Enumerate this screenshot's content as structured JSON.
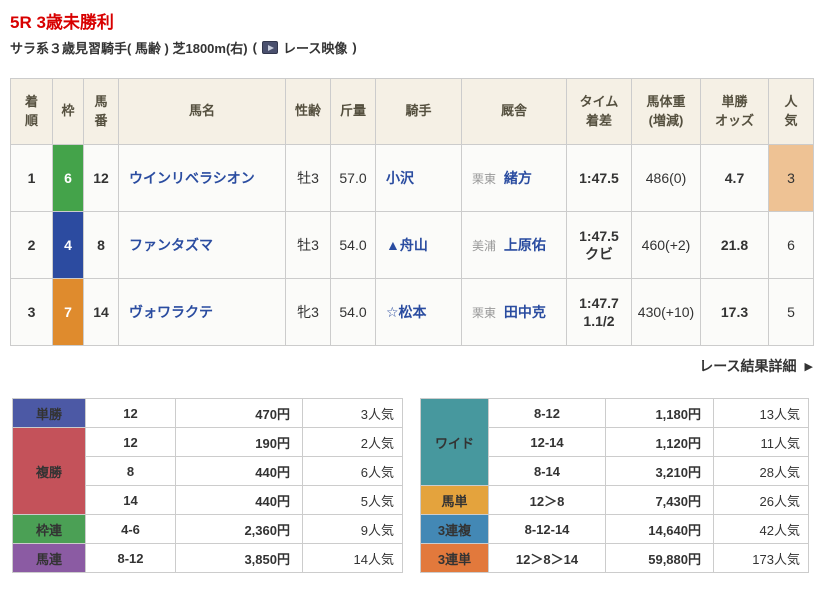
{
  "colors": {
    "title_red": "#d80000",
    "link_blue": "#2a4ca0",
    "header_beige": "#f5f0e5",
    "frame_6_green": "#44a34a",
    "frame_4_blue": "#2c4ba0",
    "frame_7_orange": "#df8b2d",
    "favorite_highlight": "#eec294"
  },
  "header": {
    "race_title": "5R 3歳未勝利",
    "race_conditions": "サラ系３歳見習騎手( 馬齢 ) 芝1800m(右)",
    "paren_open": "(",
    "video_link_label": "レース映像",
    "paren_close": ")"
  },
  "results": {
    "columns": [
      "着\n順",
      "枠",
      "馬\n番",
      "馬名",
      "性齢",
      "斤量",
      "騎手",
      "厩舎",
      "タイム\n着差",
      "馬体重\n(増減)",
      "単勝\nオッズ",
      "人\n気"
    ],
    "rows": [
      {
        "finish": "1",
        "frame": "6",
        "frame_style": "background:#44a34a;color:#ffffff",
        "number": "12",
        "name": "ウインリベラシオン",
        "sex_age": "牡3",
        "weight": "57.0",
        "jockey": "小沢",
        "stable_region": "栗東",
        "trainer": "緒方",
        "time": "1:47.5",
        "margin": "",
        "body_weight": "486(0)",
        "odds": "4.7",
        "favorite": "3",
        "favorite_style": "background:#eec294"
      },
      {
        "finish": "2",
        "frame": "4",
        "frame_style": "background:#2c4ba0;color:#ffffff",
        "number": "8",
        "name": "ファンタズマ",
        "sex_age": "牡3",
        "weight": "54.0",
        "jockey": "▲舟山",
        "stable_region": "美浦",
        "trainer": "上原佑",
        "time": "1:47.5",
        "margin": "クビ",
        "body_weight": "460(+2)",
        "odds": "21.8",
        "favorite": "6"
      },
      {
        "finish": "3",
        "frame": "7",
        "frame_style": "background:#df8b2d;color:#ffffff",
        "number": "14",
        "name": "ヴォワラクテ",
        "sex_age": "牝3",
        "weight": "54.0",
        "jockey": "☆松本",
        "stable_region": "栗東",
        "trainer": "田中克",
        "time": "1:47.7",
        "margin": "1.1/2",
        "body_weight": "430(+10)",
        "odds": "17.3",
        "favorite": "5"
      }
    ]
  },
  "details_link": {
    "label": "レース結果詳細",
    "arrow": "▶"
  },
  "payouts_left": [
    {
      "label": "単勝",
      "style": "background:#4c59a5",
      "rows": [
        {
          "sel": "12",
          "pay": "470円",
          "fav": "3人気"
        }
      ]
    },
    {
      "label": "複勝",
      "style": "background:#c4525a",
      "rows": [
        {
          "sel": "12",
          "pay": "190円",
          "fav": "2人気"
        },
        {
          "sel": "8",
          "pay": "440円",
          "fav": "6人気"
        },
        {
          "sel": "14",
          "pay": "440円",
          "fav": "5人気"
        }
      ]
    },
    {
      "label": "枠連",
      "style": "background:#4ba055",
      "rows": [
        {
          "sel": "4-6",
          "pay": "2,360円",
          "fav": "9人気"
        }
      ]
    },
    {
      "label": "馬連",
      "style": "background:#8b5ba3",
      "rows": [
        {
          "sel": "8-12",
          "pay": "3,850円",
          "fav": "14人気"
        }
      ]
    }
  ],
  "payouts_right": [
    {
      "label": "ワイド",
      "style": "background:#47989e",
      "rows": [
        {
          "sel": "8-12",
          "pay": "1,180円",
          "fav": "13人気"
        },
        {
          "sel": "12-14",
          "pay": "1,120円",
          "fav": "11人気"
        },
        {
          "sel": "8-14",
          "pay": "3,210円",
          "fav": "28人気"
        }
      ]
    },
    {
      "label": "馬単",
      "style": "background:#e4a33d",
      "rows": [
        {
          "sel": "12＞8",
          "pay": "7,430円",
          "fav": "26人気"
        }
      ]
    },
    {
      "label": "3連複",
      "style": "background:#4388b5",
      "rows": [
        {
          "sel": "8-12-14",
          "pay": "14,640円",
          "fav": "42人気"
        }
      ]
    },
    {
      "label": "3連単",
      "style": "background:#e2793c",
      "rows": [
        {
          "sel": "12＞8＞14",
          "pay": "59,880円",
          "fav": "173人気"
        }
      ]
    }
  ]
}
